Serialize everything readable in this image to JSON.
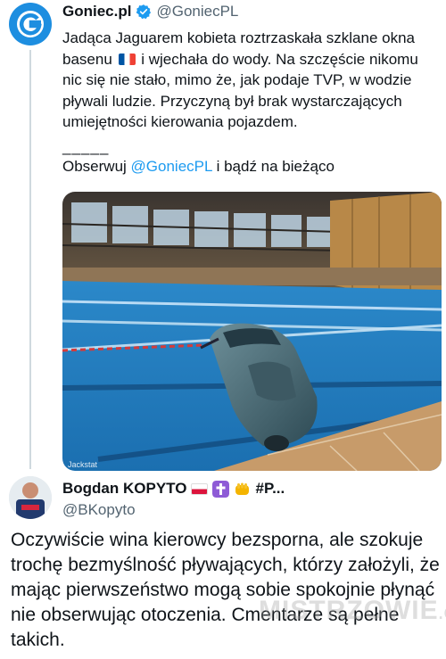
{
  "tweet1": {
    "display_name": "Goniec.pl",
    "handle": "@GoniecPL",
    "text_part1": "Jadąca Jaguarem kobieta roztrzaskała szklane okna basenu",
    "text_part2": "i wjechała do wody. Na szczęście nikomu nic się nie stało, mimo że, jak podaje TVP, w wodzie pływali ludzie. Przyczyną był brak wystarczających umiejętności kierowania pojazdem.",
    "separator": "_____",
    "follow_prefix": "Obserwuj",
    "follow_mention": "@GoniecPL",
    "follow_suffix": "i bądź na bieżąco",
    "media_credit": "Jackstat",
    "icons": [
      "goniec-logo-icon",
      "verified-badge-icon",
      "france-flag-icon"
    ]
  },
  "tweet2": {
    "display_name": "Bogdan KOPYTO",
    "display_name_suffix": "#P...",
    "handle": "@BKopyto",
    "text": "Oczywiście wina kierowcy bezsporna, ale szokuje trochę bezmyślność pływających, którzy założyli, że mając pierwszeństwo mogą sobie spokojnie płynąć nie obserwując otoczenia. Cmentarze są pełne takich.",
    "icons": [
      "poland-flag-icon",
      "cross-emoji-icon",
      "fist-emoji-icon"
    ]
  },
  "watermark": {
    "main": "MISTRZOWIE",
    "suffix": ".ORG"
  },
  "colors": {
    "link": "#1d9bf0",
    "brand": "#1d8ee0",
    "verified": "#1d9bf0",
    "pool": "#2f86c8"
  }
}
